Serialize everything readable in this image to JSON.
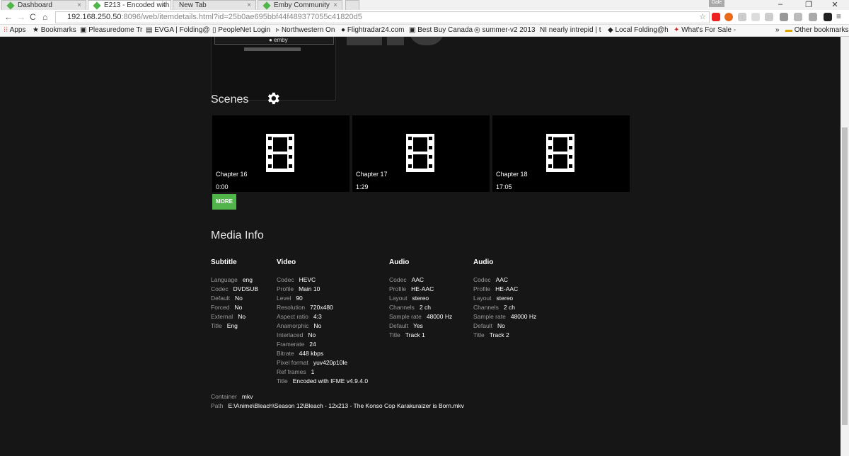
{
  "browser": {
    "tabs": [
      {
        "title": "Dashboard"
      },
      {
        "title": "E213 - Encoded with"
      },
      {
        "title": "New Tab"
      },
      {
        "title": "Emby Community"
      }
    ],
    "user_badge": "Dale",
    "url_host": "192.168.250.50",
    "url_rest": ":8096/web/itemdetails.html?id=25b0ae695bbf44f489377055c41820d5",
    "bookmarks": [
      "Apps",
      "Bookmarks",
      "Pleasuredome Tr",
      "EVGA | Folding@",
      "PeopleNet Login",
      "Northwestern On",
      "Flightradar24.com",
      "Best Buy Canada",
      "summer-v2 2013",
      "nearly intrepid | t",
      "Local Folding@h",
      "What's For Sale -"
    ],
    "overflow": "»",
    "other_bookmarks": "Other bookmarks",
    "logo_text": "emby"
  },
  "scenes": {
    "title": "Scenes",
    "items": [
      {
        "name": "Chapter 16",
        "time": "0:00"
      },
      {
        "name": "Chapter 17",
        "time": "1:29"
      },
      {
        "name": "Chapter 18",
        "time": "17:05"
      }
    ],
    "more": "MORE"
  },
  "media_info": {
    "title": "Media Info",
    "streams": [
      {
        "heading": "Subtitle",
        "rows": [
          [
            "Language",
            "eng"
          ],
          [
            "Codec",
            "DVDSUB"
          ],
          [
            "Default",
            "No"
          ],
          [
            "Forced",
            "No"
          ],
          [
            "External",
            "No"
          ],
          [
            "Title",
            "Eng"
          ]
        ]
      },
      {
        "heading": "Video",
        "rows": [
          [
            "Codec",
            "HEVC"
          ],
          [
            "Profile",
            "Main 10"
          ],
          [
            "Level",
            "90"
          ],
          [
            "Resolution",
            "720x480"
          ],
          [
            "Aspect ratio",
            "4:3"
          ],
          [
            "Anamorphic",
            "No"
          ],
          [
            "Interlaced",
            "No"
          ],
          [
            "Framerate",
            "24"
          ],
          [
            "Bitrate",
            "448 kbps"
          ],
          [
            "Pixel format",
            "yuv420p10le"
          ],
          [
            "Ref frames",
            "1"
          ],
          [
            "Title",
            "Encoded with IFME v4.9.4.0"
          ]
        ]
      },
      {
        "heading": "Audio",
        "rows": [
          [
            "Codec",
            "AAC"
          ],
          [
            "Profile",
            "HE-AAC"
          ],
          [
            "Layout",
            "stereo"
          ],
          [
            "Channels",
            "2 ch"
          ],
          [
            "Sample rate",
            "48000 Hz"
          ],
          [
            "Default",
            "Yes"
          ],
          [
            "Title",
            "Track 1"
          ]
        ]
      },
      {
        "heading": "Audio",
        "rows": [
          [
            "Codec",
            "AAC"
          ],
          [
            "Profile",
            "HE-AAC"
          ],
          [
            "Layout",
            "stereo"
          ],
          [
            "Channels",
            "2 ch"
          ],
          [
            "Sample rate",
            "48000 Hz"
          ],
          [
            "Default",
            "No"
          ],
          [
            "Title",
            "Track 2"
          ]
        ]
      }
    ],
    "container_label": "Container",
    "container": "mkv",
    "path_label": "Path",
    "path": "E:\\Anime\\Bleach\\Season 12\\Bleach - 12x213 - The Konso Cop Karakuraizer is Born.mkv"
  }
}
